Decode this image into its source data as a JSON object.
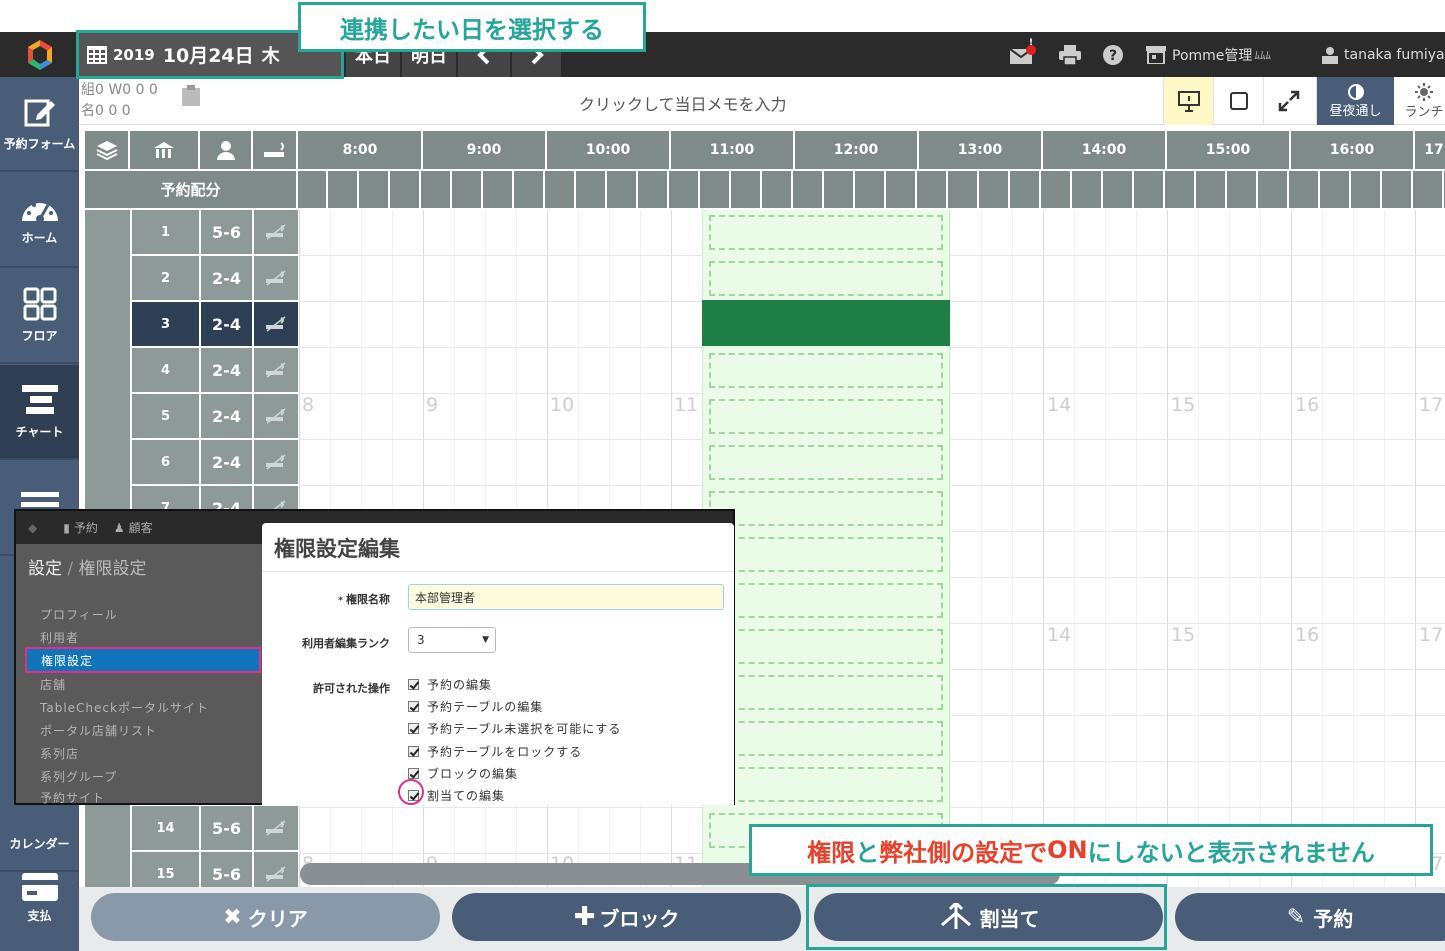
{
  "callouts": {
    "select_date": "連携したい日を選択する",
    "note_part1": "権限",
    "note_part2": "と",
    "note_part3": "弊社側の設定で",
    "note_part4": "ON",
    "note_part5": "にしないと表示されません"
  },
  "header": {
    "year": "2019",
    "month_day": "10月24日",
    "weekday": "木",
    "today": "本日",
    "tomorrow": "明日",
    "prev": "<",
    "next": ">",
    "notification_badge": "!",
    "store_name": "Pomme管理",
    "user_name": "tanaka fumiya"
  },
  "sidebar": {
    "items": [
      {
        "label": "予約フォーム",
        "icon": "edit-form-icon"
      },
      {
        "label": "ホーム",
        "icon": "dashboard-icon"
      },
      {
        "label": "フロア",
        "icon": "floor-grid-icon"
      },
      {
        "label": "チャート",
        "icon": "chart-icon"
      },
      {
        "label": "",
        "icon": "list-icon"
      },
      {
        "label": "カレンダー",
        "icon": "calendar-icon"
      },
      {
        "label": "支払",
        "icon": "card-icon"
      }
    ]
  },
  "toolbar": {
    "counts_row1": "組0 W0  0  0",
    "counts_row2": "名0   0   0",
    "memo_placeholder": "クリックして当日メモを入力",
    "daynight": "昼夜通し",
    "lunch": "ランチ"
  },
  "grid": {
    "allocation_label": "予約配分",
    "hours": [
      "8:00",
      "9:00",
      "10:00",
      "11:00",
      "12:00",
      "13:00",
      "14:00",
      "15:00",
      "16:00",
      "17"
    ],
    "ghost_hours": [
      "8",
      "9",
      "10",
      "11",
      "14",
      "15",
      "16",
      "17"
    ],
    "tables": [
      {
        "no": "1",
        "cap": "5-6"
      },
      {
        "no": "2",
        "cap": "2-4"
      },
      {
        "no": "3",
        "cap": "2-4"
      },
      {
        "no": "4",
        "cap": "2-4"
      },
      {
        "no": "5",
        "cap": "2-4"
      },
      {
        "no": "6",
        "cap": "2-4"
      },
      {
        "no": "7",
        "cap": "2-4"
      },
      {
        "no": "14",
        "cap": "5-6"
      },
      {
        "no": "15",
        "cap": "5-6"
      }
    ]
  },
  "dialog": {
    "topnav": [
      "予約",
      "顧客"
    ],
    "breadcrumb_main": "設定",
    "breadcrumb_sub": "権限設定",
    "menu": [
      "プロフィール",
      "利用者",
      "権限設定",
      "店舗",
      "TableCheckポータルサイト",
      "ポータル店舗リスト",
      "系列店",
      "系列グループ",
      "予約サイト"
    ],
    "panel_title": "権限設定編集",
    "name_label": "権限名称",
    "name_value": "本部管理者",
    "rank_label": "利用者編集ランク",
    "rank_value": "3",
    "ops_label": "許可された操作",
    "ops": [
      "予約の編集",
      "予約テーブルの編集",
      "予約テーブル未選択を可能にする",
      "予約テーブルをロックする",
      "ブロックの編集",
      "割当ての編集"
    ]
  },
  "bottom": {
    "clear": "クリア",
    "block": "ブロック",
    "assign": "割当て",
    "reserve": "予約"
  },
  "colors": {
    "accent_teal": "#26a59a",
    "sidebar": "#4a5d78",
    "assigned_green": "#1e7e45",
    "note_red": "#e8402a"
  }
}
